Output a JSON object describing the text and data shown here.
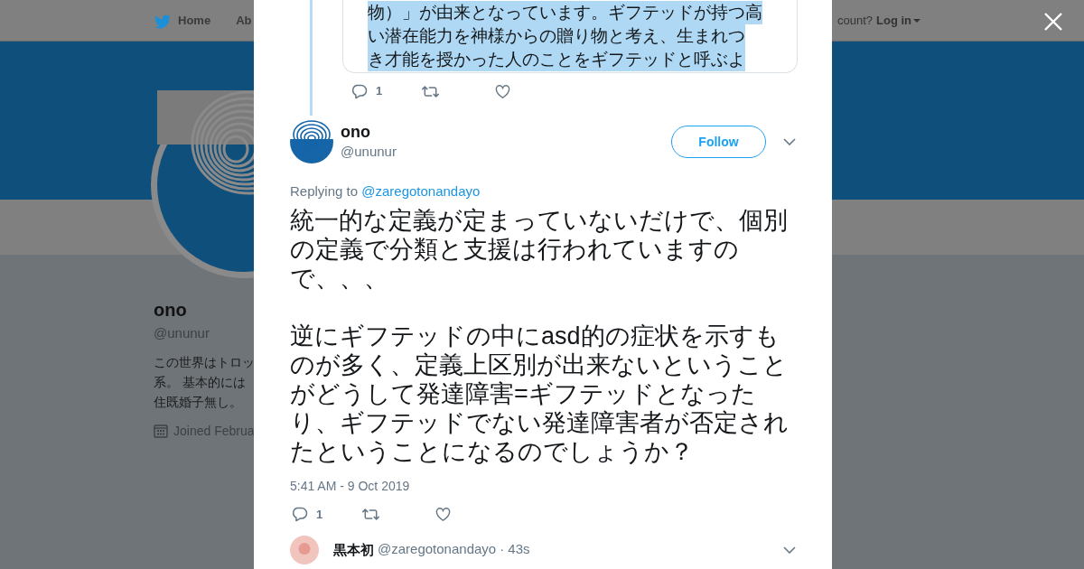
{
  "background": {
    "nav": {
      "items": [
        {
          "label": "Home"
        },
        {
          "label": "Ab"
        }
      ],
      "account_prompt": "count?",
      "login": "Log in"
    },
    "profile": {
      "name": "ono",
      "handle": "@ununur",
      "bio": [
        "この世界はトロッ",
        "系。 基本的には",
        "住既婚子無し。"
      ],
      "joined": "Joined Februa"
    }
  },
  "modal": {
    "quoted_lines": [
      "物）」が由来となっています。ギフテッドが持つ高",
      "い潜在能力を神様からの贈り物と考え、生まれつ",
      "き才能を授かった人のことをギフテッドと呼ぶよ"
    ],
    "parent_replies": "1",
    "tweet": {
      "name": "ono",
      "handle": "@ununur",
      "follow": "Follow",
      "replying_label": "Replying to",
      "replying_to": "@zaregotonandayo",
      "paragraphs": [
        "統一的な定義が定まっていないだけで、個別の定義で分類と支援は行われていますので、、、",
        "逆にギフテッドの中にasd的の症状を示すものが多く、定義上区別が出来ないということがどうして発達障害=ギフテッドとなったり、ギフテッドでない発達障害者が否定されたということになるのでしょうか？"
      ],
      "time": "5:41 AM - 9 Oct 2019",
      "replies": "1"
    },
    "next_reply": {
      "name": "黒本初",
      "handle": "@zaregotonandayo",
      "age": "· 43s"
    }
  }
}
